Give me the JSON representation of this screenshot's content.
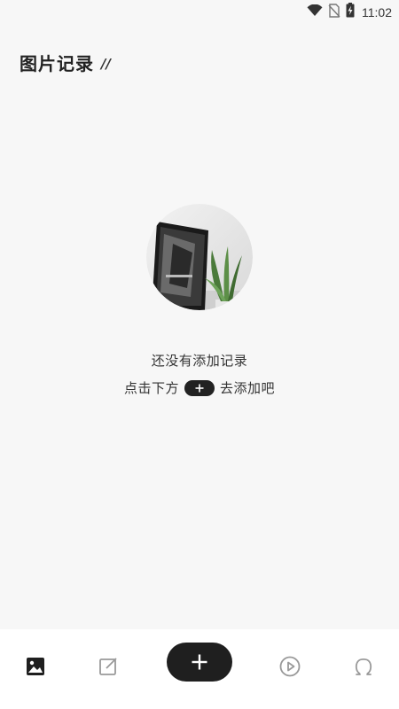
{
  "status_bar": {
    "time": "11:02",
    "icons": [
      "wifi-icon",
      "no-sim-icon",
      "battery-charging-icon"
    ]
  },
  "header": {
    "title": "图片记录",
    "suffix": "//"
  },
  "empty_state": {
    "title": "还没有添加记录",
    "hint_before": "点击下方",
    "hint_after": "去添加吧",
    "hint_icon": "plus-icon"
  },
  "bottom_nav": {
    "items": [
      {
        "name": "image-icon",
        "active": true
      },
      {
        "name": "edit-icon",
        "active": false
      },
      {
        "name": "add-icon",
        "active": false
      },
      {
        "name": "play-icon",
        "active": false
      },
      {
        "name": "user-icon",
        "active": false
      }
    ]
  },
  "colors": {
    "background": "#f7f7f7",
    "primary": "#1f1f1f",
    "inactive_icon": "#999999",
    "nav_background": "#ffffff"
  }
}
